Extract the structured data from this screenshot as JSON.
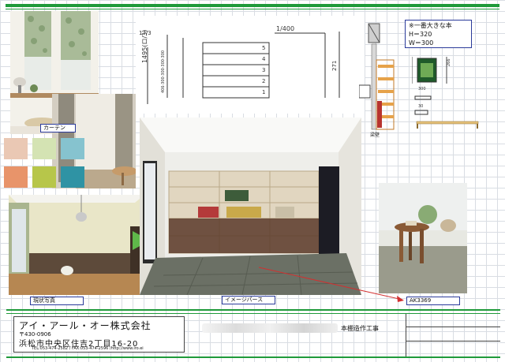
{
  "labels": {
    "curtain": "カーテン",
    "current_photo": "現状写真",
    "image_perse": "イメージパース",
    "product_code": "AK3369"
  },
  "spec_box": {
    "line1": "※一番大きな本",
    "line2": "H＝320",
    "line3": "W＝300"
  },
  "sketch": {
    "height_dim": "1495(ロ/3)",
    "width_dim": "1/400",
    "right_dim": "271",
    "top_dim": "17/3",
    "shelf_numbers": [
      "5",
      "4",
      "3",
      "2",
      "1"
    ],
    "left_stack": "406·300·300·300·300"
  },
  "section": {
    "label": "梁壁",
    "dim1": "300",
    "dim2": "30",
    "small_dim": "266"
  },
  "title_block": {
    "company_name": "アイ・アール・オー株式会社",
    "postal": "〒430-0906",
    "address": "浜松市中央区住吉2丁目16-20",
    "contact": "TEL:053-474-2582 / FAX:053-474-2596 /http://www.iro.ei",
    "project": "本棚造作工事"
  },
  "colors": {
    "accent_green": "#1f9a3a",
    "label_border": "#2a3a9a",
    "arrow_red": "#d23030"
  }
}
